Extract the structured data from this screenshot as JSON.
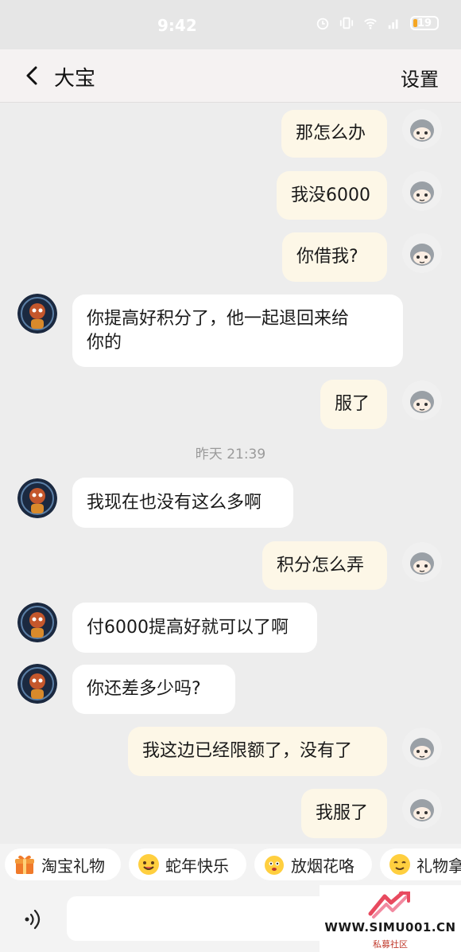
{
  "status_bar": {
    "time": "9:42",
    "battery": "19"
  },
  "header": {
    "title": "大宝",
    "settings": "设置"
  },
  "messages": [
    {
      "side": "me",
      "text": "那怎么办"
    },
    {
      "side": "me",
      "text": "我没6000"
    },
    {
      "side": "me",
      "text": "你借我?"
    },
    {
      "side": "them",
      "line1": "你提高好积分了，他一起退回来给",
      "line2": "你的"
    },
    {
      "side": "me",
      "text": "服了"
    },
    {
      "side": "them",
      "text": "我现在也没有这么多啊"
    },
    {
      "side": "me",
      "text": "积分怎么弄"
    },
    {
      "side": "them",
      "text": "付6000提高好就可以了啊"
    },
    {
      "side": "them",
      "text": "你还差多少吗?"
    },
    {
      "side": "me",
      "text": "我这边已经限额了，没有了"
    },
    {
      "side": "me",
      "text": "我服了"
    }
  ],
  "timestamp": "昨天 21:39",
  "quick_actions": [
    {
      "label": "淘宝礼物",
      "icon": "gift-icon"
    },
    {
      "label": "蛇年快乐",
      "icon": "emoji-icon"
    },
    {
      "label": "放烟花咯",
      "icon": "emoji-icon"
    },
    {
      "label": "礼物拿",
      "icon": "emoji-icon"
    }
  ],
  "watermark": {
    "text": "WWW.SIMU001.CN",
    "sub": "私募社区"
  }
}
